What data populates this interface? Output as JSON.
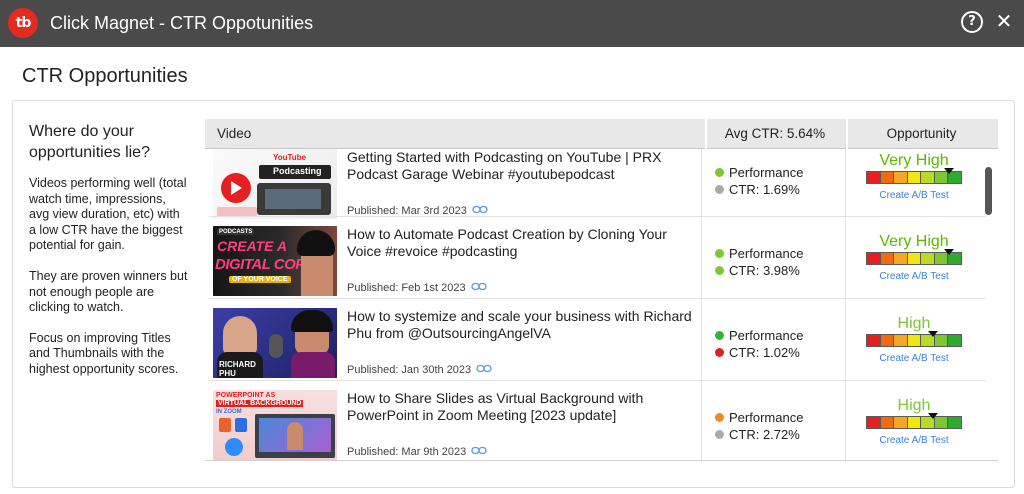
{
  "window": {
    "logo_text": "tb",
    "title": "Click Magnet - CTR Oppotunities",
    "help_glyph": "?",
    "close_glyph": "✕",
    "icons": [
      "tubebuddy-logo-icon",
      "help-icon",
      "close-icon"
    ]
  },
  "page": {
    "title": "CTR Opportunities"
  },
  "sidebar": {
    "heading": "Where do your opportunities lie?",
    "paragraphs": [
      "Videos performing well (total watch time, impressions, avg view duration, etc) with a low CTR have the biggest potential for gain.",
      "They are proven winners but not enough people are clicking to watch.",
      "Focus on improving Titles and Thumbnails with the highest opportunity scores."
    ]
  },
  "table": {
    "headers": {
      "video": "Video",
      "avg_ctr": "Avg CTR: 5.64%",
      "opportunity": "Opportunity"
    },
    "rows": [
      {
        "title": "Getting Started with Podcasting on YouTube | PRX Podcast Garage Webinar #youtubepodcast",
        "published": "Published: Mar 3rd 2023",
        "thumb_text": {
          "top": "YouTube",
          "badge": "Podcasting"
        },
        "performance_label": "Performance",
        "performance_color": "#7dc832",
        "ctr_label": "CTR: 1.69%",
        "ctr_color": "#aaaaaa",
        "opportunity": "Very High",
        "opportunity_level": 0.92,
        "ab_link": "Create A/B Test"
      },
      {
        "title": "How to Automate Podcast Creation by Cloning Your Voice #revoice #podcasting",
        "published": "Published: Feb 1st 2023",
        "thumb_text": {
          "small": "PODCASTS",
          "main1": "CREATE A",
          "main2": "DIGITAL COPY",
          "banner": "OF YOUR VOICE"
        },
        "performance_label": "Performance",
        "performance_color": "#7dc832",
        "ctr_label": "CTR: 3.98%",
        "ctr_color": "#7dc832",
        "opportunity": "Very High",
        "opportunity_level": 0.92,
        "ab_link": "Create A/B Test"
      },
      {
        "title": "How to systemize and scale your business with Richard Phu from @OutsourcingAngelVA",
        "published": "Published: Jan 30th 2023",
        "thumb_text": {
          "name1": "RICHARD",
          "name2": "PHU"
        },
        "performance_label": "Performance",
        "performance_color": "#2fb52f",
        "ctr_label": "CTR: 1.02%",
        "ctr_color": "#e02020",
        "opportunity": "High",
        "opportunity_level": 0.68,
        "ab_link": "Create A/B Test"
      },
      {
        "title": "How to Share Slides as Virtual Background with PowerPoint in Zoom Meeting [2023 update]",
        "published": "Published: Mar 9th 2023",
        "thumb_text": {
          "line1": "POWERPOINT AS",
          "line2": "VIRTUAL BACKGROUND",
          "line3": "IN ZOOM"
        },
        "performance_label": "Performance",
        "performance_color": "#f08c1e",
        "ctr_label": "CTR: 2.72%",
        "ctr_color": "#aaaaaa",
        "opportunity": "High",
        "opportunity_level": 0.68,
        "ab_link": "Create A/B Test"
      }
    ]
  },
  "meter_colors": [
    "#e62020",
    "#f26a10",
    "#f5a623",
    "#f2e612",
    "#b6dd22",
    "#7dc832",
    "#2faa2f"
  ]
}
